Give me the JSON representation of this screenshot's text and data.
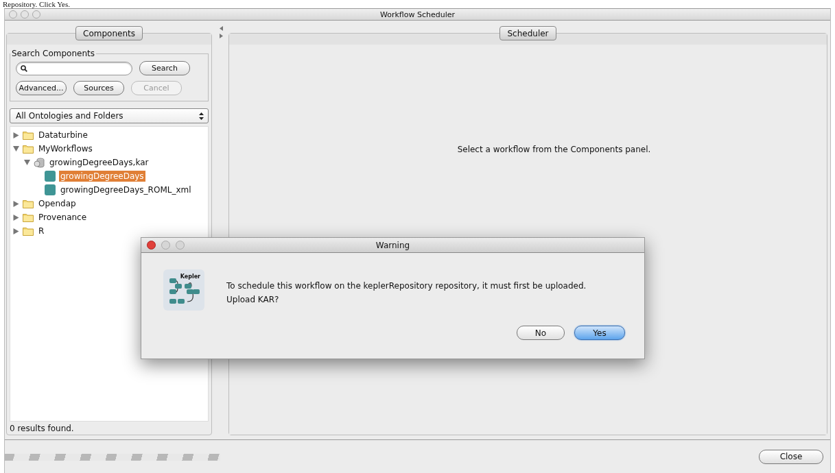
{
  "caption": "Repository. Click Yes.",
  "window": {
    "title": "Workflow Scheduler"
  },
  "components_panel": {
    "tab": "Components",
    "search_group": {
      "title": "Search Components",
      "buttons": [
        {
          "label": "Search",
          "disabled": false
        },
        {
          "label": "Advanced...",
          "disabled": false
        },
        {
          "label": "Sources",
          "disabled": false
        },
        {
          "label": "Cancel",
          "disabled": true
        }
      ]
    },
    "dropdown": {
      "value": "All Ontologies and Folders"
    },
    "tree": [
      {
        "label": "Dataturbine",
        "kind": "folder",
        "expanded": false,
        "selected": false
      },
      {
        "label": "MyWorkflows",
        "kind": "folder",
        "expanded": true,
        "selected": false,
        "children": [
          {
            "label": "growingDegreeDays,kar",
            "kind": "kar",
            "expanded": true,
            "selected": false,
            "children": [
              {
                "label": "growingDegreeDays",
                "kind": "workflow",
                "selected": true
              },
              {
                "label": "growingDegreeDays_ROML_xml",
                "kind": "workflow",
                "selected": false
              }
            ]
          }
        ]
      },
      {
        "label": "Opendap",
        "kind": "folder",
        "expanded": false,
        "selected": false
      },
      {
        "label": "Provenance",
        "kind": "folder",
        "expanded": false,
        "selected": false
      },
      {
        "label": "R",
        "kind": "folder",
        "expanded": false,
        "selected": false
      }
    ],
    "status": "0 results found."
  },
  "scheduler_panel": {
    "tab": "Scheduler",
    "message": "Select a workflow from the Components panel."
  },
  "dialog": {
    "title": "Warning",
    "logo_text": "Kepler",
    "message_lines": [
      "To schedule this workflow on the keplerRepository repository, it must first be uploaded.",
      "Upload KAR?"
    ],
    "buttons": [
      {
        "label": "No",
        "default": false
      },
      {
        "label": "Yes",
        "default": true
      }
    ]
  },
  "progress": {
    "indeterminate": true
  },
  "close_button": "Close"
}
